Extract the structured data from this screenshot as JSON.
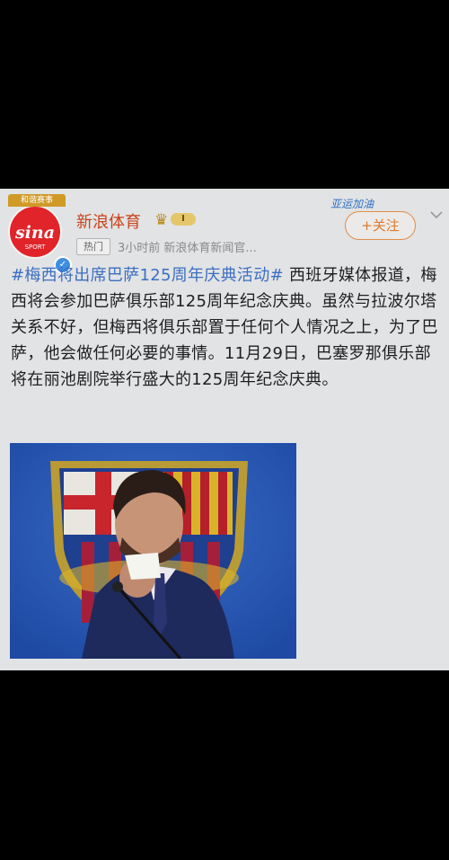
{
  "avatar": {
    "ribbon": "和谐赛事",
    "logo": "sina",
    "sub": "SPORT"
  },
  "account": {
    "name": "新浪体育",
    "level": "I"
  },
  "post_meta": {
    "hot_badge": "热门",
    "time": "3小时前",
    "source": "新浪体育新闻官..."
  },
  "promo_text": "亚运加油",
  "follow_label": "+关注",
  "post": {
    "hashtag": "#梅西将出席巴萨125周年庆典活动#",
    "body": " 西班牙媒体报道，梅西将会参加巴萨俱乐部125周年纪念庆典。虽然与拉波尔塔关系不好，但梅西将俱乐部置于任何个人情况之上，为了巴萨，他会做任何必要的事情。11月29日，巴塞罗那俱乐部将在丽池剧院举行盛大的125周年纪念庆典。"
  },
  "photo": {
    "subject": "Messi in suit holding tissue in front of FC Barcelona crest"
  },
  "colors": {
    "accent_orange": "#e07a2e",
    "hashtag_blue": "#3b6fc2",
    "brand_red": "#e0242a"
  }
}
